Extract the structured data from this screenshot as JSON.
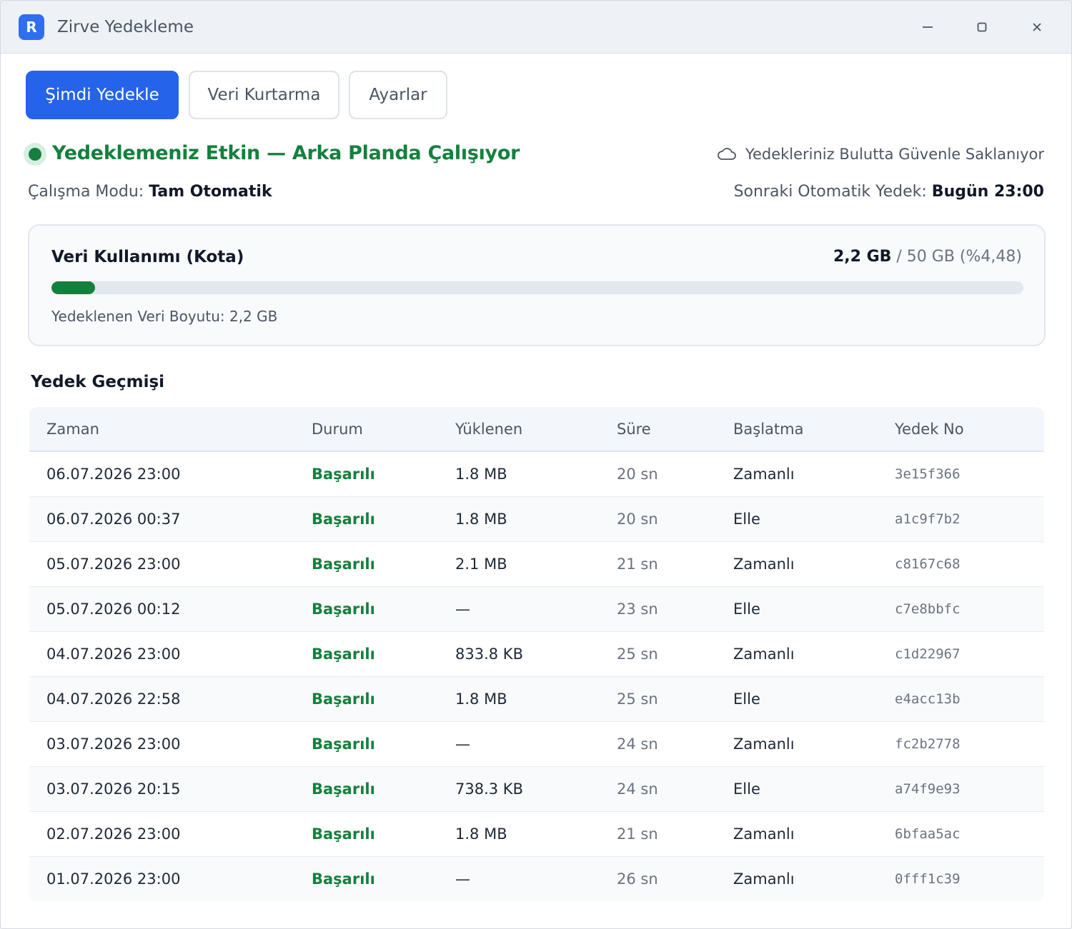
{
  "app": {
    "logo_letter": "R",
    "title": "Zirve Yedekleme"
  },
  "toolbar": {
    "backup_now": "Şimdi Yedekle",
    "restore": "Veri Kurtarma",
    "settings": "Ayarlar"
  },
  "status": {
    "message": "Yedeklemeniz Etkin — Arka Planda Çalışıyor",
    "color": "#15803d",
    "cloud_note": "Yedekleriniz Bulutta Güvenle Saklanıyor",
    "mode_label": "Çalışma Modu:",
    "mode_value": "Tam Otomatik",
    "next_label": "Sonraki Otomatik Yedek:",
    "next_value": "Bugün 23:00"
  },
  "quota": {
    "title": "Veri Kullanımı (Kota)",
    "used": "2,2 GB",
    "total_text": "/ 50 GB (%4,48)",
    "percent": 4.48,
    "backed_up_label": "Yedeklenen Veri Boyutu: 2,2 GB"
  },
  "history": {
    "title": "Yedek Geçmişi",
    "columns": [
      "Zaman",
      "Durum",
      "Yüklenen",
      "Süre",
      "Başlatma",
      "Yedek No"
    ],
    "rows": [
      {
        "time": "06.07.2026 23:00",
        "status": "Başarılı",
        "uploaded": "1.8 MB",
        "duration": "20 sn",
        "trigger": "Zamanlı",
        "id": "3e15f366"
      },
      {
        "time": "06.07.2026 00:37",
        "status": "Başarılı",
        "uploaded": "1.8 MB",
        "duration": "20 sn",
        "trigger": "Elle",
        "id": "a1c9f7b2"
      },
      {
        "time": "05.07.2026 23:00",
        "status": "Başarılı",
        "uploaded": "2.1 MB",
        "duration": "21 sn",
        "trigger": "Zamanlı",
        "id": "c8167c68"
      },
      {
        "time": "05.07.2026 00:12",
        "status": "Başarılı",
        "uploaded": "—",
        "duration": "23 sn",
        "trigger": "Elle",
        "id": "c7e8bbfc"
      },
      {
        "time": "04.07.2026 23:00",
        "status": "Başarılı",
        "uploaded": "833.8 KB",
        "duration": "25 sn",
        "trigger": "Zamanlı",
        "id": "c1d22967"
      },
      {
        "time": "04.07.2026 22:58",
        "status": "Başarılı",
        "uploaded": "1.8 MB",
        "duration": "25 sn",
        "trigger": "Elle",
        "id": "e4acc13b"
      },
      {
        "time": "03.07.2026 23:00",
        "status": "Başarılı",
        "uploaded": "—",
        "duration": "24 sn",
        "trigger": "Zamanlı",
        "id": "fc2b2778"
      },
      {
        "time": "03.07.2026 20:15",
        "status": "Başarılı",
        "uploaded": "738.3 KB",
        "duration": "24 sn",
        "trigger": "Elle",
        "id": "a74f9e93"
      },
      {
        "time": "02.07.2026 23:00",
        "status": "Başarılı",
        "uploaded": "1.8 MB",
        "duration": "21 sn",
        "trigger": "Zamanlı",
        "id": "6bfaa5ac"
      },
      {
        "time": "01.07.2026 23:00",
        "status": "Başarılı",
        "uploaded": "—",
        "duration": "26 sn",
        "trigger": "Zamanlı",
        "id": "0fff1c39"
      }
    ]
  },
  "icons": {
    "window_controls": [
      "minimize-icon",
      "maximize-icon",
      "close-icon"
    ],
    "cloud": "cloud-icon",
    "status_dot": "status-dot-icon"
  },
  "colors": {
    "accent": "#2563eb",
    "success": "#15803d",
    "progress_track": "#e2e8f0"
  }
}
